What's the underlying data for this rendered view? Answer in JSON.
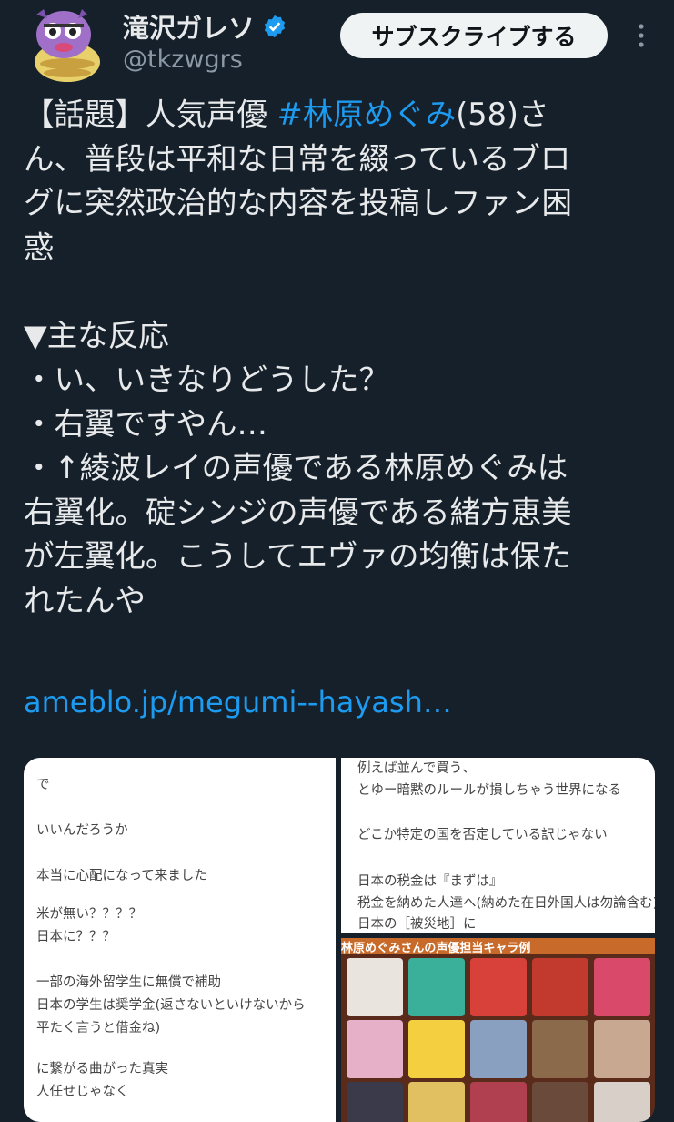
{
  "header": {
    "display_name": "滝沢ガレソ",
    "handle": "@tkzwgrs",
    "subscribe_label": "サブスクライブする"
  },
  "tweet": {
    "line1_pre": "【話題】人気声優 ",
    "hashtag": "#林原めぐみ",
    "line1_post": "(58)さ",
    "body": "ん、普段は平和な日常を綴っているブロ\nグに突然政治的な内容を投稿しファン困\n惑\n\n▼主な反応\n・い、いきなりどうした？\n・右翼ですやん…\n・↑綾波レイの声優である林原めぐみは\n右翼化。碇シンジの声優である緒方恵美\nが左翼化。こうしてエヴァの均衡は保た\nれたんや",
    "link": "ameblo.jp/megumi--hayash…"
  },
  "media": {
    "image1_lines": [
      "で",
      "いいんだろうか",
      "本当に心配になって来ました",
      "米が無い？？？？",
      "日本に？？？",
      "一部の海外留学生に無償で補助",
      "日本の学生は奨学金(返さないといけないから",
      "平たく言うと借金ね)",
      "に繋がる曲がった真実",
      "人任せじゃなく"
    ],
    "image2_lines": [
      "例えば並んで買う、",
      "とゆー暗黙のルールが損しちゃう世界になる",
      "どこか特定の国を否定している訳じゃない",
      "日本の税金は『まずは』",
      "税金を納めた人達へ(納めた在日外国人は勿論含む)",
      "日本の［被災地］に"
    ],
    "image3_title": "林原めぐみさんの声優担当キャラ例",
    "accent": "#1d9bf0"
  }
}
